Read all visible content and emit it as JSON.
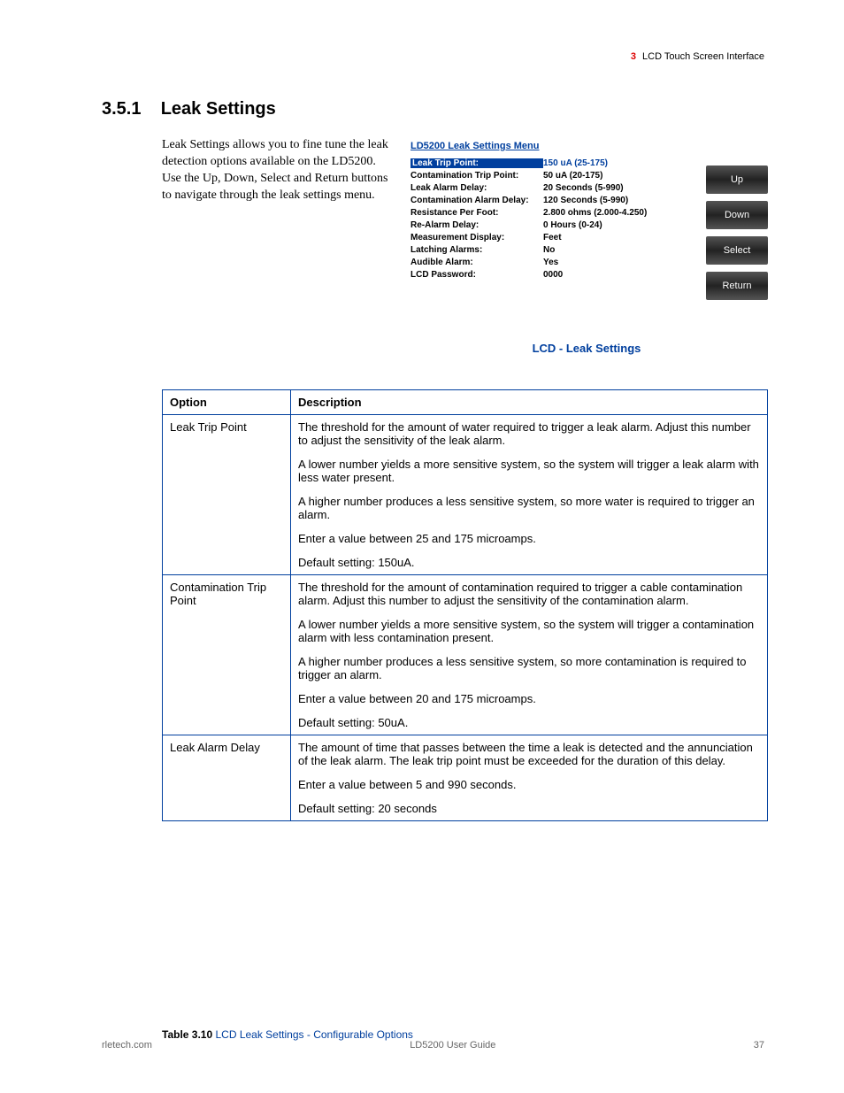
{
  "header": {
    "chapter_num": "3",
    "chapter_title": "LCD Touch Screen Interface"
  },
  "section": {
    "number": "3.5.1",
    "title": "Leak Settings"
  },
  "intro": "Leak Settings allows you to fine tune the leak detection options available on the LD5200. Use the Up, Down, Select and Return buttons to navigate through the leak settings menu.",
  "lcd": {
    "title": "LD5200 Leak Settings Menu",
    "rows": [
      {
        "label": "Leak Trip Point:",
        "value": "150 uA (25-175)",
        "selected": true
      },
      {
        "label": "Contamination Trip Point:",
        "value": "50 uA (20-175)",
        "selected": false
      },
      {
        "label": "Leak Alarm Delay:",
        "value": "20 Seconds (5-990)",
        "selected": false
      },
      {
        "label": "Contamination Alarm Delay:",
        "value": "120 Seconds (5-990)",
        "selected": false
      },
      {
        "label": "Resistance Per Foot:",
        "value": "2.800 ohms (2.000-4.250)",
        "selected": false
      },
      {
        "label": "Re-Alarm Delay:",
        "value": "0 Hours (0-24)",
        "selected": false
      },
      {
        "label": "Measurement Display:",
        "value": "Feet",
        "selected": false
      },
      {
        "label": "Latching Alarms:",
        "value": "No",
        "selected": false
      },
      {
        "label": "Audible Alarm:",
        "value": "Yes",
        "selected": false
      },
      {
        "label": "LCD Password:",
        "value": "0000",
        "selected": false
      }
    ],
    "buttons": [
      "Up",
      "Down",
      "Select",
      "Return"
    ],
    "caption": "LCD - Leak Settings"
  },
  "table": {
    "headers": [
      "Option",
      "Description"
    ],
    "rows": [
      {
        "option": "Leak Trip Point",
        "desc": [
          "The threshold for the amount of water required to trigger a leak alarm. Adjust this number to adjust the sensitivity of the leak alarm.",
          "A lower number yields a more sensitive system, so the system will trigger a leak alarm with less water present.",
          "A higher number produces a less sensitive system, so more water is required to trigger an alarm.",
          "Enter a value between 25 and 175 microamps.",
          "Default setting: 150uA."
        ]
      },
      {
        "option": "Contamination Trip Point",
        "desc": [
          "The threshold for the amount of contamination required to trigger a cable contamination alarm. Adjust this number to adjust the sensitivity of the contamination alarm.",
          "A lower number yields a more sensitive system, so the system will trigger a contamination alarm with less contamination present.",
          "A higher number produces a less sensitive system, so more contamination is required to trigger an alarm.",
          "Enter a value between 20 and 175 microamps.",
          "Default setting: 50uA."
        ]
      },
      {
        "option": "Leak Alarm Delay",
        "desc": [
          "The amount of time that passes between the time a leak is detected and the annunciation of the leak alarm. The leak trip point must be exceeded for the duration of this delay.",
          "Enter a value between 5 and 990 seconds.",
          "Default setting: 20 seconds"
        ]
      }
    ],
    "caption_bold": "Table 3.10",
    "caption_rest": "  LCD Leak Settings - Configurable Options"
  },
  "footer": {
    "left": "rletech.com",
    "center": "LD5200 User Guide",
    "right": "37"
  }
}
